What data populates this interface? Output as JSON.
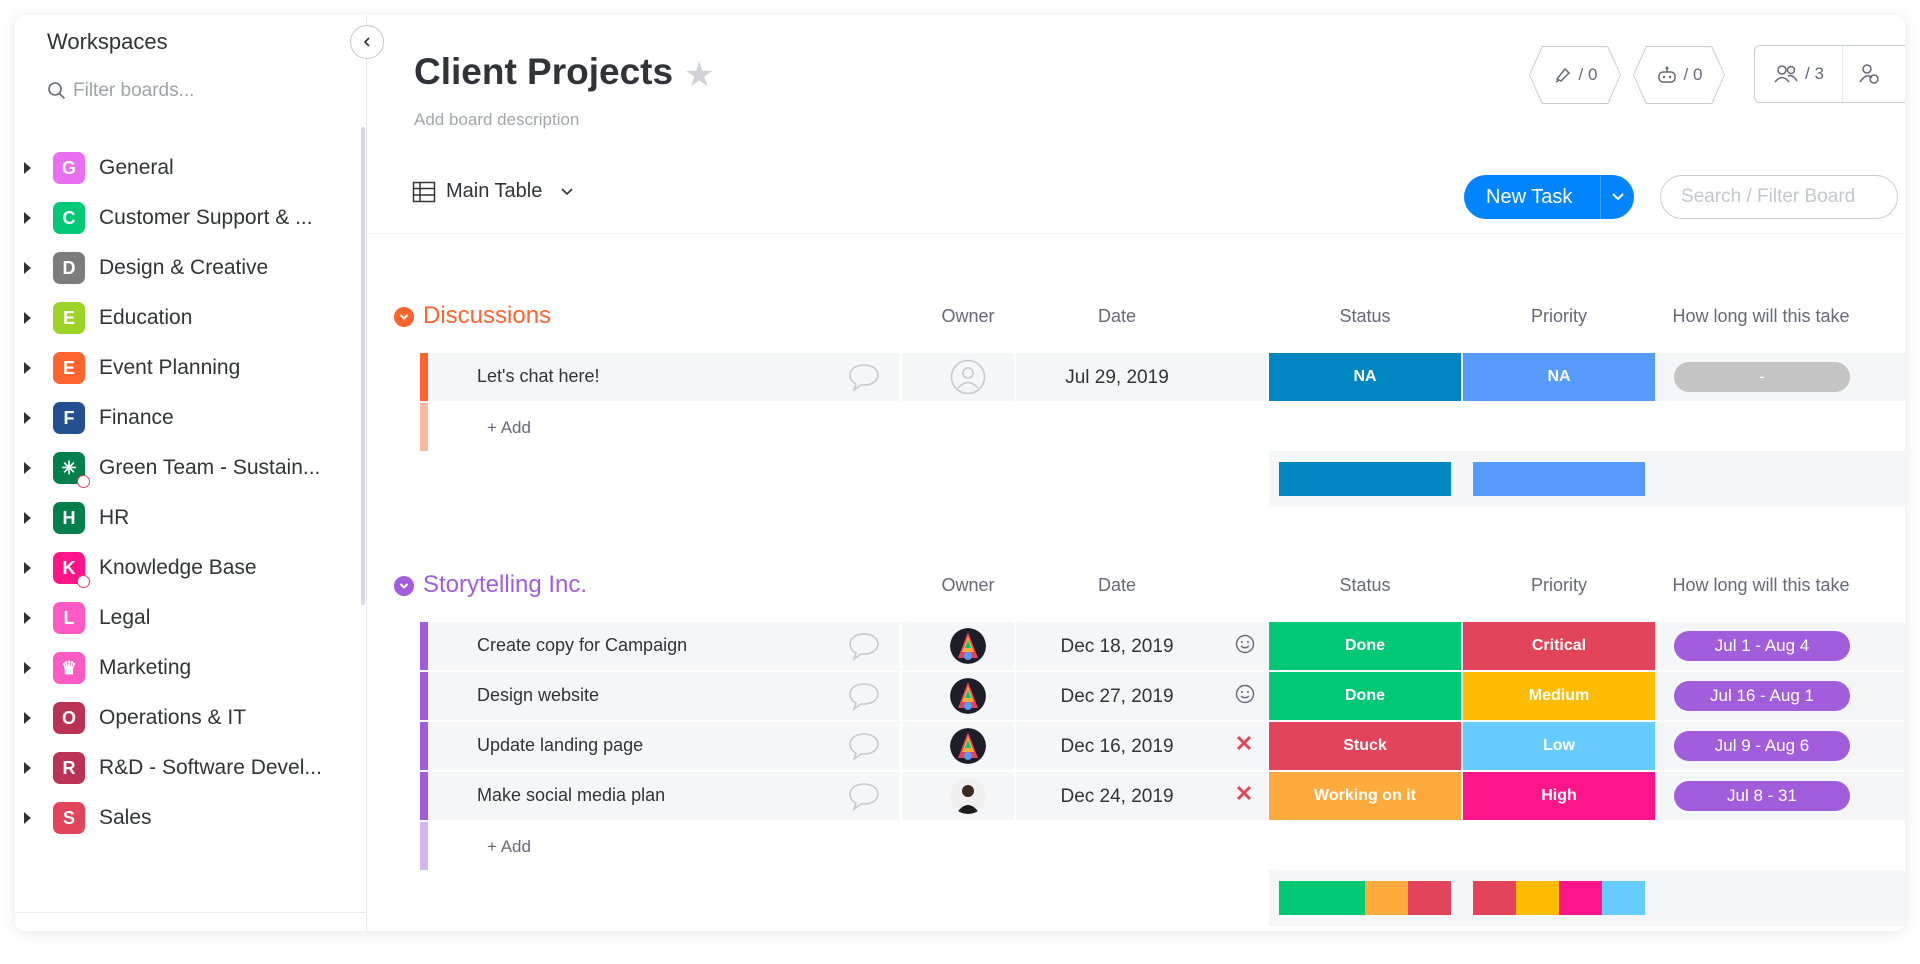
{
  "sidebar": {
    "title": "Workspaces",
    "filter_placeholder": "Filter boards...",
    "workspaces": [
      {
        "letter": "G",
        "label": "General",
        "color": "#e86ff0",
        "locked": false
      },
      {
        "letter": "C",
        "label": "Customer Support & ...",
        "color": "#00c875",
        "locked": false
      },
      {
        "letter": "D",
        "label": "Design & Creative",
        "color": "#7c7c7c",
        "locked": false
      },
      {
        "letter": "E",
        "label": "Education",
        "color": "#9cd326",
        "locked": false
      },
      {
        "letter": "E",
        "label": "Event Planning",
        "color": "#ff642e",
        "locked": false
      },
      {
        "letter": "F",
        "label": "Finance",
        "color": "#225091",
        "locked": false
      },
      {
        "letter": "✳",
        "label": "Green Team - Sustain...",
        "color": "#037f4c",
        "locked": true
      },
      {
        "letter": "H",
        "label": "HR",
        "color": "#037f4c",
        "locked": false
      },
      {
        "letter": "K",
        "label": "Knowledge Base",
        "color": "#ff158a",
        "locked": true
      },
      {
        "letter": "L",
        "label": "Legal",
        "color": "#ff5ac4",
        "locked": false
      },
      {
        "letter": "♛",
        "label": "Marketing",
        "color": "#ff5ac4",
        "locked": false
      },
      {
        "letter": "O",
        "label": "Operations & IT",
        "color": "#bb3354",
        "locked": false
      },
      {
        "letter": "R",
        "label": "R&D - Software Devel...",
        "color": "#bb3354",
        "locked": false
      },
      {
        "letter": "S",
        "label": "Sales",
        "color": "#e2445c",
        "locked": false
      }
    ]
  },
  "board": {
    "title": "Client Projects",
    "description_placeholder": "Add board description",
    "activity_count": "/ 0",
    "automation_count": "/ 0",
    "members_count": "/ 3",
    "view_label": "Main Table",
    "new_task_label": "New Task",
    "search_placeholder": "Search / Filter Board"
  },
  "columns": {
    "owner": "Owner",
    "date": "Date",
    "status": "Status",
    "priority": "Priority",
    "time": "How long will this take"
  },
  "add_label": "+ Add",
  "groups": [
    {
      "name": "Discussions",
      "color": "#ff642e",
      "rows": [
        {
          "task": "Let's chat here!",
          "owner": "empty",
          "date": "Jul 29, 2019",
          "date_icon": "",
          "status": "NA",
          "status_color": "#0086c0",
          "priority": "NA",
          "priority_color": "#579bfc",
          "time": "-",
          "time_color": "#c4c4c4"
        }
      ],
      "summary_status": [
        {
          "color": "#0086c0",
          "share": 1
        }
      ],
      "summary_priority": [
        {
          "color": "#579bfc",
          "share": 1
        }
      ]
    },
    {
      "name": "Storytelling Inc.",
      "color": "#a25ddc",
      "rows": [
        {
          "task": "Create copy for Campaign",
          "owner": "avatar-colorful",
          "date": "Dec 18, 2019",
          "date_icon": "smile",
          "status": "Done",
          "status_color": "#00c875",
          "priority": "Critical",
          "priority_color": "#e2445c",
          "time": "Jul 1 - Aug 4",
          "time_color": "#a25ddc"
        },
        {
          "task": "Design website",
          "owner": "avatar-colorful",
          "date": "Dec 27, 2019",
          "date_icon": "smile",
          "status": "Done",
          "status_color": "#00c875",
          "priority": "Medium",
          "priority_color": "#fdbc00",
          "time": "Jul 16 - Aug 1",
          "time_color": "#a25ddc"
        },
        {
          "task": "Update landing page",
          "owner": "avatar-colorful",
          "date": "Dec 16, 2019",
          "date_icon": "x",
          "status": "Stuck",
          "status_color": "#e2445c",
          "priority": "Low",
          "priority_color": "#66ccff",
          "time": "Jul 9 - Aug 6",
          "time_color": "#a25ddc"
        },
        {
          "task": "Make social media plan",
          "owner": "avatar-person",
          "date": "Dec 24, 2019",
          "date_icon": "x",
          "status": "Working on it",
          "status_color": "#fdab3d",
          "priority": "High",
          "priority_color": "#ff158a",
          "time": "Jul 8 - 31",
          "time_color": "#a25ddc"
        }
      ],
      "summary_status": [
        {
          "color": "#00c875",
          "share": 0.5
        },
        {
          "color": "#fdab3d",
          "share": 0.25
        },
        {
          "color": "#e2445c",
          "share": 0.25
        }
      ],
      "summary_priority": [
        {
          "color": "#e2445c",
          "share": 0.25
        },
        {
          "color": "#fdbc00",
          "share": 0.25
        },
        {
          "color": "#ff158a",
          "share": 0.25
        },
        {
          "color": "#66ccff",
          "share": 0.25
        }
      ]
    }
  ]
}
